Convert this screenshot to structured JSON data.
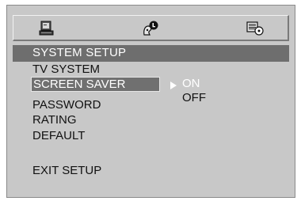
{
  "icon_bar": {
    "tabs": [
      {
        "icon": "general-setup-icon"
      },
      {
        "icon": "audio-setup-icon"
      },
      {
        "icon": "video-setup-icon"
      }
    ]
  },
  "menu": {
    "title": "SYSTEM SETUP",
    "items": [
      {
        "label": "TV SYSTEM"
      },
      {
        "label": "SCREEN SAVER",
        "selected": true
      },
      {
        "label": "PASSWORD"
      },
      {
        "label": "RATING"
      },
      {
        "label": "DEFAULT"
      },
      {
        "label": "EXIT SETUP"
      }
    ]
  },
  "submenu": {
    "options": [
      {
        "label": "ON",
        "highlighted": true
      },
      {
        "label": "OFF"
      }
    ]
  },
  "colors": {
    "background": "#c8c8c8",
    "title_bar": "#6e6e6e",
    "selected_item": "#707070",
    "highlighted_option_text": "#ffffff"
  }
}
